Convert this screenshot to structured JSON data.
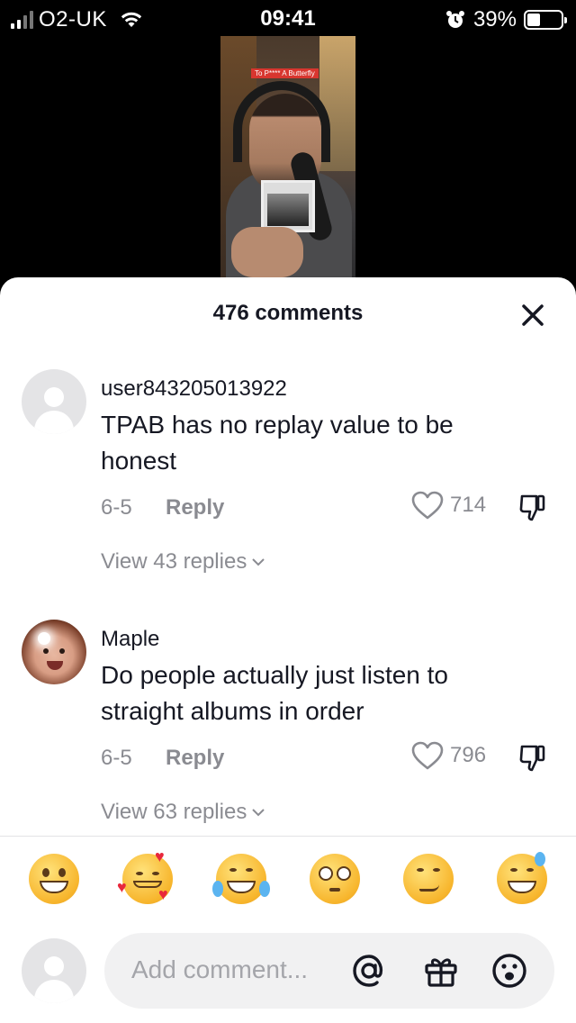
{
  "status_bar": {
    "carrier": "O2-UK",
    "time": "09:41",
    "battery_percent": "39%",
    "battery_level": 0.39
  },
  "video": {
    "caption": "To P**** A Butterfly"
  },
  "comments_sheet": {
    "title": "476 comments",
    "close_icon": "close-icon",
    "comments": [
      {
        "username": "user843205013922",
        "text": "TPAB has no replay value to be honest",
        "date": "6-5",
        "reply_label": "Reply",
        "likes": "714",
        "view_replies": "View 43 replies"
      },
      {
        "username": "Maple",
        "text": "Do people actually just listen to straight albums in order",
        "date": "6-5",
        "reply_label": "Reply",
        "likes": "796",
        "view_replies": "View 63 replies"
      }
    ]
  },
  "emoji_bar": {
    "emojis": [
      "grinning-face",
      "smiling-face-with-hearts",
      "tears-of-joy",
      "flushed-face",
      "smirking-face",
      "grinning-face-with-sweat"
    ]
  },
  "comment_input": {
    "placeholder": "Add comment...",
    "icons": [
      "at-icon",
      "gift-icon",
      "emoji-icon"
    ]
  },
  "colors": {
    "text_primary": "#161823",
    "text_secondary": "#8a8b91",
    "input_bg": "#f1f1f2"
  }
}
